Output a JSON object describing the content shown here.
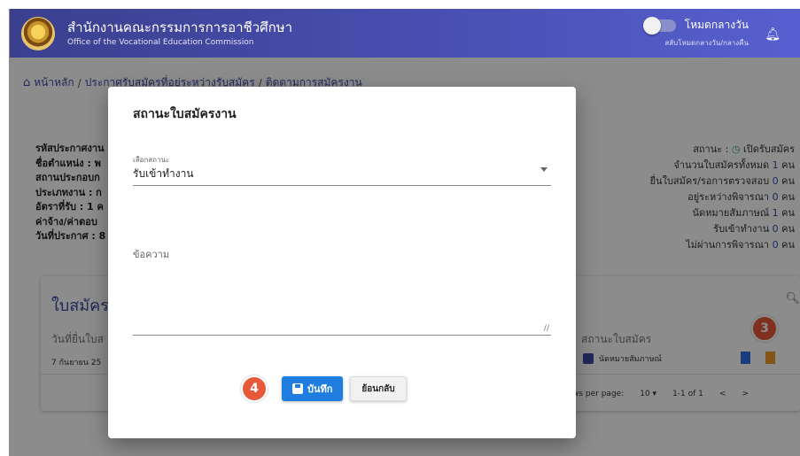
{
  "header": {
    "title_th": "สำนักงานคณะกรรมการการอาชีวศึกษา",
    "title_en": "Office of the Vocational Education Commission",
    "mode_label": "โหมดกลางวัน",
    "mode_sub": "สลับโหมดกลางวัน/กลางคืน"
  },
  "breadcrumb": {
    "home": "หน้าหลัก",
    "level2": "ประกาศรับสมัครที่อยู่ระหว่างรับสมัคร",
    "level3": "ติดตามการสมัครงาน",
    "sep": "/"
  },
  "info_left": [
    "รหัสประกาศงาน",
    "ชื่อตำแหน่ง : พ",
    "สถานประกอบก",
    "ประเภทงาน : ก",
    "อัตราที่รับ : 1 ค",
    "ค่าจ้าง/ค่าตอบ",
    "วันที่ประกาศ : 8"
  ],
  "info_right": {
    "status_prefix": "สถานะ :",
    "status_value": "เปิดรับสมัคร",
    "rows": [
      {
        "label": "จำนวนใบสมัครทั้งหมด",
        "num": "1",
        "unit": "คน"
      },
      {
        "label": "ยื่นใบสมัคร/รอการตรวจสอบ",
        "num": "0",
        "unit": "คน"
      },
      {
        "label": "อยู่ระหว่างพิจารณา",
        "num": "0",
        "unit": "คน"
      },
      {
        "label": "นัดหมายสัมภาษณ์",
        "num": "1",
        "unit": "คน"
      },
      {
        "label": "รับเข้าทำงาน",
        "num": "0",
        "unit": "คน"
      },
      {
        "label": "ไม่ผ่านการพิจารณา",
        "num": "0",
        "unit": "คน"
      }
    ]
  },
  "card": {
    "title": "ใบสมัครง",
    "col_date": "วันที่ยื่นใบส",
    "col_status": "สถานะใบสมัคร",
    "row_date": "7 กันยายน 25",
    "row_status": "นัดหมายสัมภาษณ์",
    "badge": "3",
    "rows_per_page_label": "ws per page:",
    "rows_per_page_value": "10",
    "range": "1-1 of 1",
    "prev": "<",
    "next": ">"
  },
  "dialog": {
    "title": "สถานะใบสมัครงาน",
    "select_label": "เลือกสถานะ",
    "select_value": "รับเข้าทำงาน",
    "textarea_label": "ข้อความ",
    "badge": "4",
    "save_label": "บันทึก",
    "back_label": "ย้อนกลับ"
  }
}
